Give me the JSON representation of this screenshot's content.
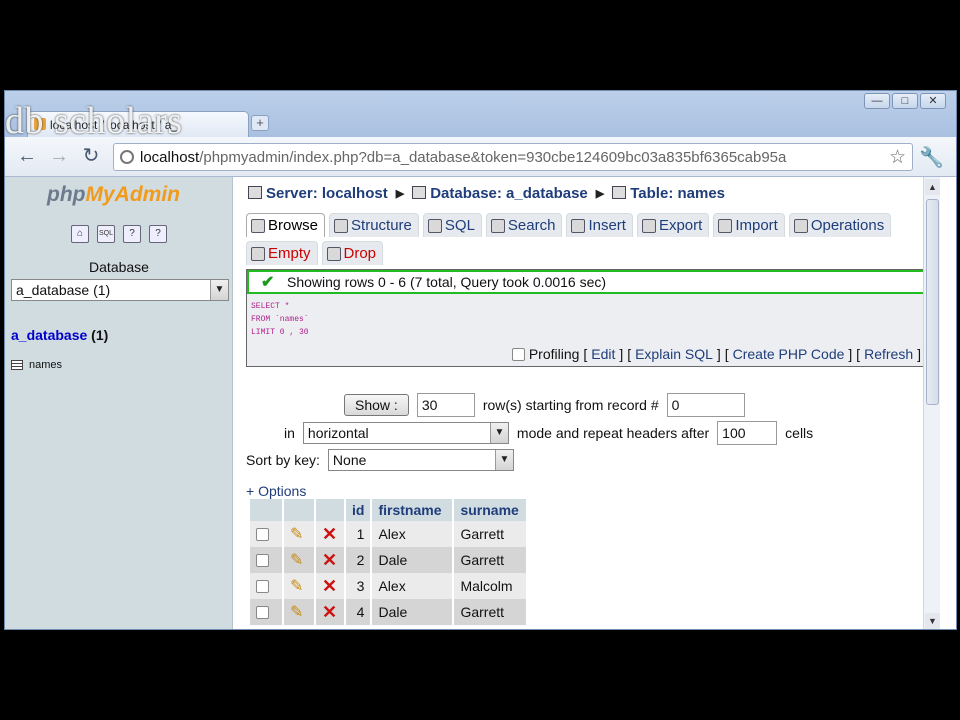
{
  "watermark": "db scholars",
  "browser": {
    "tab_title": "localhost / localhost / a_",
    "new_tab": "+",
    "window_controls": [
      "—",
      "□",
      "✕"
    ],
    "url_host": "localhost",
    "url_path": "/phpmyadmin/index.php?db=a_database&token=930cbe124609bc03a835bf6365cab95a"
  },
  "left": {
    "logo_php": "php",
    "logo_myadmin": "MyAdmin",
    "icons": [
      "home-icon",
      "sql-icon",
      "docs-icon",
      "help-icon"
    ],
    "icon_glyphs": [
      "⌂",
      "SQL",
      "?",
      "?"
    ],
    "database_label": "Database",
    "database_selected": "a_database (1)",
    "db_link": "a_database",
    "db_count": "(1)",
    "table_name": "names"
  },
  "breadcrumb": {
    "server": "Server: localhost",
    "database": "Database: a_database",
    "table": "Table: names"
  },
  "tabs": [
    "Browse",
    "Structure",
    "SQL",
    "Search",
    "Insert",
    "Export",
    "Import",
    "Operations"
  ],
  "tabs2": [
    "Empty",
    "Drop"
  ],
  "notice": "Showing rows 0 - 6 (7 total, Query took 0.0016 sec)",
  "sql": {
    "line1": "SELECT *",
    "line2": "FROM `names`",
    "line3": "LIMIT 0 , 30",
    "profiling": "Profiling",
    "links": [
      "Edit",
      "Explain SQL",
      "Create PHP Code",
      "Refresh"
    ]
  },
  "controls": {
    "show_button": "Show :",
    "rows_value": "30",
    "rows_label": "row(s) starting from record #",
    "start_value": "0",
    "in_label": "in",
    "mode_value": "horizontal",
    "mode_label": "mode and repeat headers after",
    "repeat_value": "100",
    "cells_label": "cells",
    "sort_label": "Sort by key:",
    "sort_value": "None",
    "options_link": "+ Options"
  },
  "table": {
    "headers": [
      "id",
      "firstname",
      "surname"
    ],
    "rows": [
      {
        "id": "1",
        "firstname": "Alex",
        "surname": "Garrett"
      },
      {
        "id": "2",
        "firstname": "Dale",
        "surname": "Garrett"
      },
      {
        "id": "3",
        "firstname": "Alex",
        "surname": "Malcolm"
      },
      {
        "id": "4",
        "firstname": "Dale",
        "surname": "Garrett"
      }
    ]
  }
}
